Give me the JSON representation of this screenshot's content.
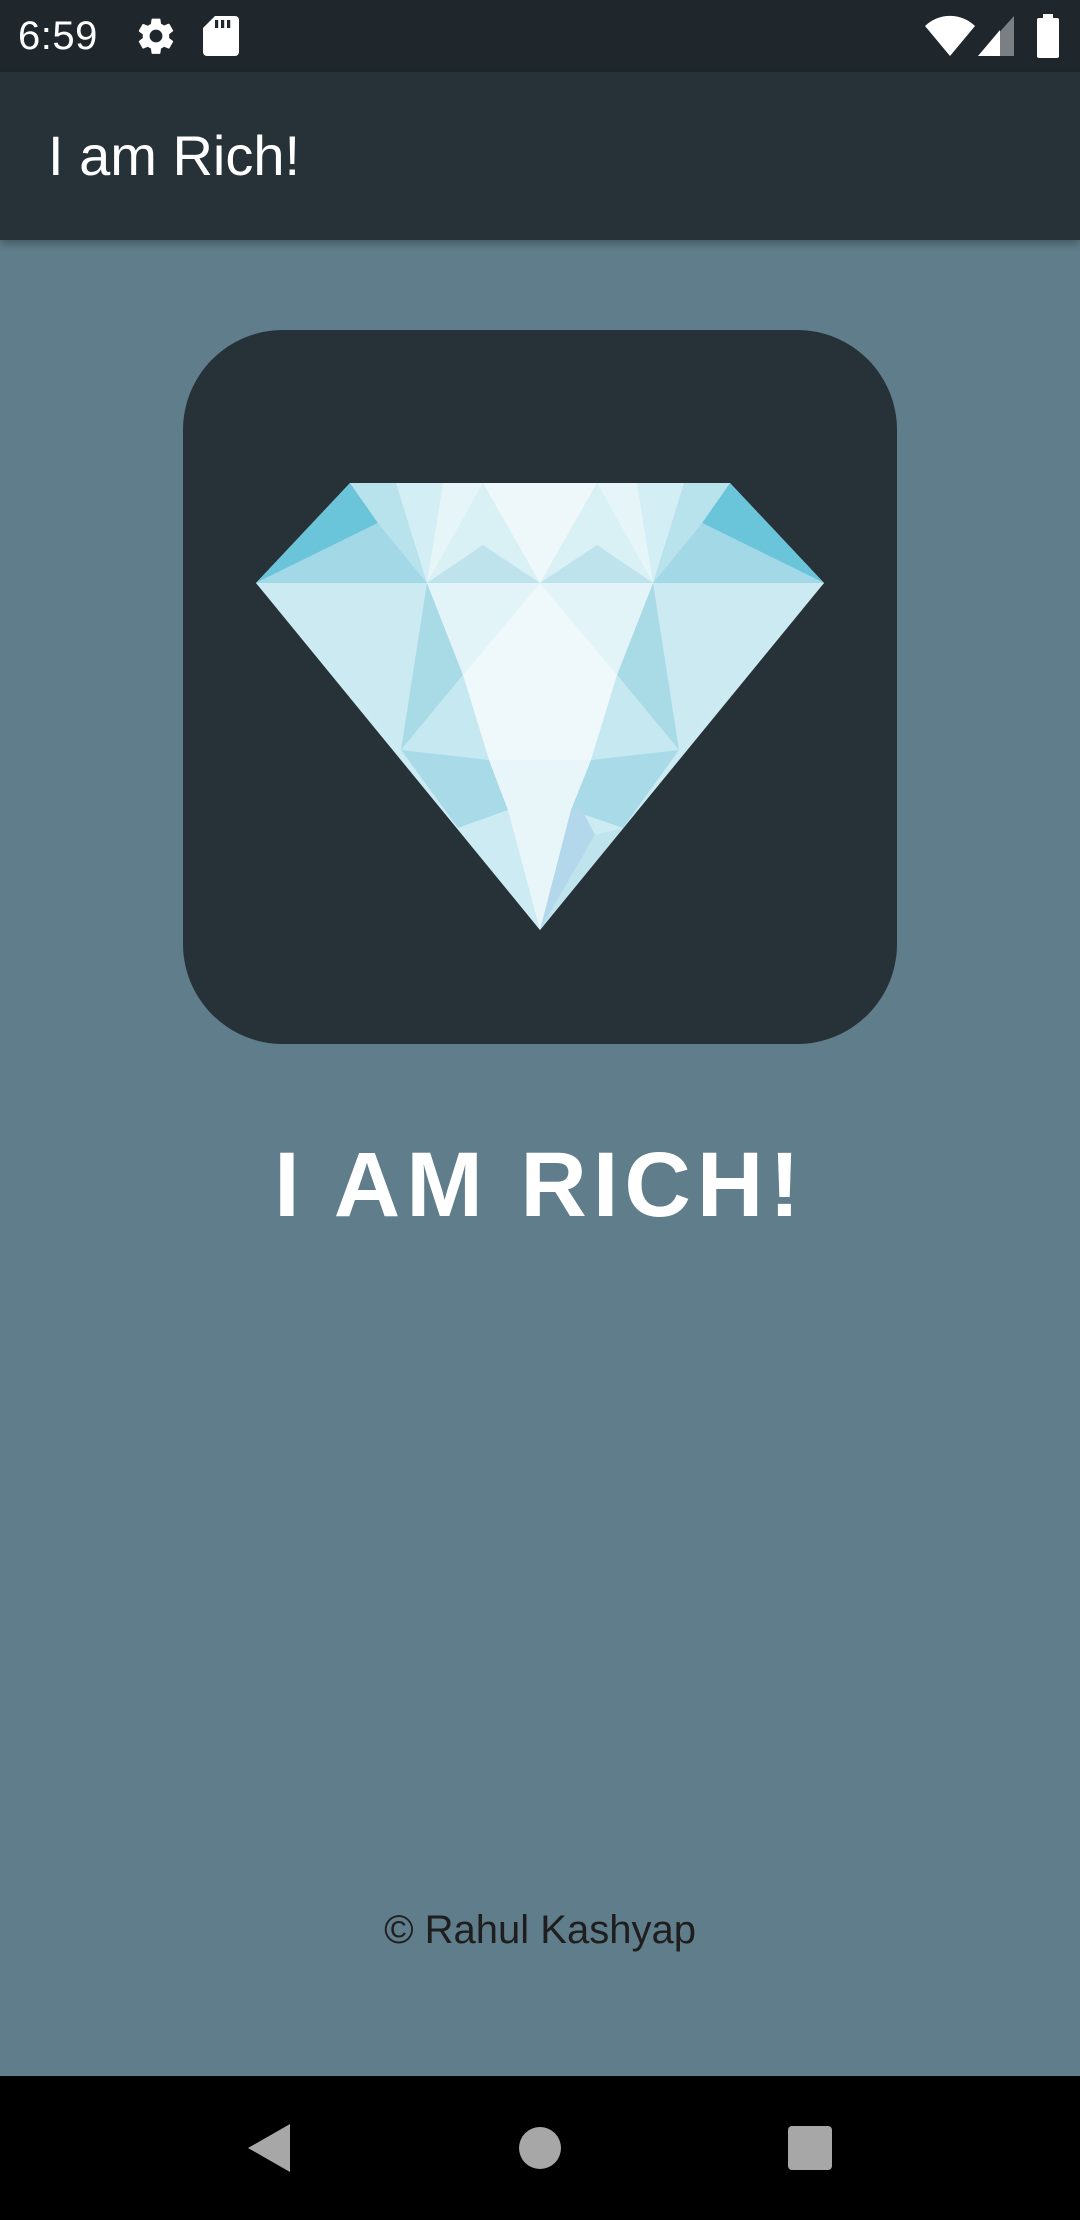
{
  "status_bar": {
    "time": "6:59",
    "left_icons": [
      "gear-icon",
      "sd-card-icon"
    ],
    "right_icons": [
      "wifi-icon",
      "cell-signal-icon",
      "battery-icon"
    ]
  },
  "app_bar": {
    "title": "I am Rich!",
    "background": "#263238"
  },
  "main": {
    "background": "#607D8B",
    "image": {
      "icon": "diamond-icon",
      "card_color": "#263238"
    },
    "headline": "I AM RICH!",
    "credit": "© Rahul Kashyap"
  },
  "nav_bar": {
    "buttons": [
      "back-icon",
      "home-icon",
      "recents-icon"
    ]
  }
}
